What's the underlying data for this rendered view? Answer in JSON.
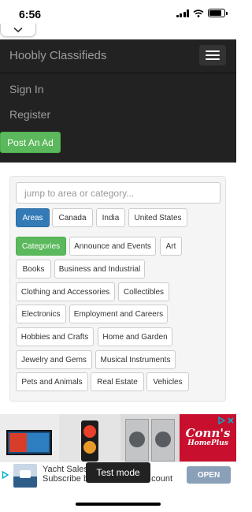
{
  "status_bar": {
    "time": "6:56"
  },
  "navbar": {
    "brand": "Hoobly Classifieds",
    "links": [
      {
        "label": "Sign In"
      },
      {
        "label": "Register"
      }
    ],
    "post_ad_label": "Post An Ad"
  },
  "search": {
    "placeholder": "jump to area or category...",
    "value": ""
  },
  "areas": [
    {
      "label": "Areas",
      "active": true
    },
    {
      "label": "Canada"
    },
    {
      "label": "India"
    },
    {
      "label": "United States"
    }
  ],
  "categories": [
    {
      "label": "Categories",
      "active": true
    },
    {
      "label": "Announce and Events"
    },
    {
      "label": "Art"
    },
    {
      "label": "Books"
    },
    {
      "label": "Business and Industrial"
    },
    {
      "label": "Clothing and Accessories"
    },
    {
      "label": "Collectibles"
    },
    {
      "label": "Electronics"
    },
    {
      "label": "Employment and Careers"
    },
    {
      "label": "Hobbies and Crafts"
    },
    {
      "label": "Home and Garden"
    },
    {
      "label": "Jewelry and Gems"
    },
    {
      "label": "Musical Instruments"
    },
    {
      "label": "Pets and Animals"
    },
    {
      "label": "Real Estate"
    },
    {
      "label": "Vehicles"
    }
  ],
  "ad": {
    "brand_name": "Conn's",
    "brand_sub": "HomePlus",
    "line1": "Yacht Sales",
    "line2": "Subscribe b",
    "line2_tail": "count",
    "open_label": "OPEN",
    "test_mode_label": "Test mode"
  },
  "colors": {
    "navbar": "#222222",
    "primary": "#337ab7",
    "success": "#5cb85c"
  }
}
